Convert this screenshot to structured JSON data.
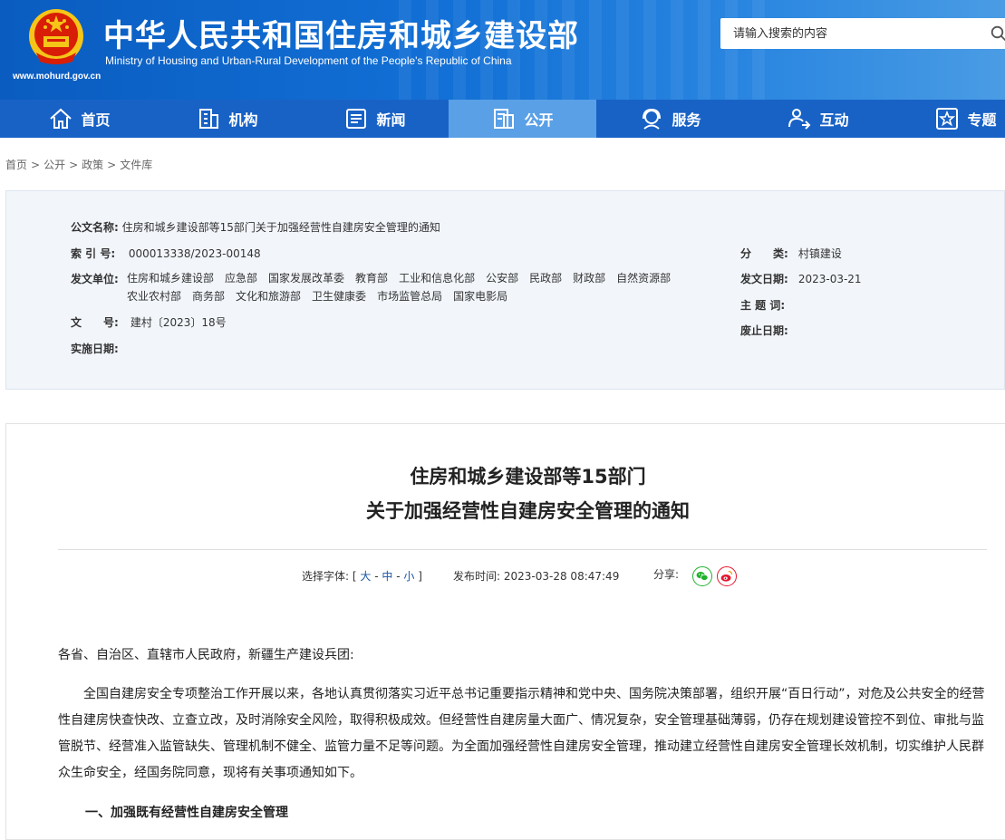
{
  "header": {
    "title_cn": "中华人民共和国住房和城乡建设部",
    "title_en": "Ministry of Housing and Urban-Rural Development of the People's Republic of China",
    "url": "www.mohurd.gov.cn",
    "search_placeholder": "请输入搜索的内容"
  },
  "nav": {
    "items": [
      {
        "label": "首页",
        "icon": "home-icon"
      },
      {
        "label": "机构",
        "icon": "building-icon"
      },
      {
        "label": "新闻",
        "icon": "news-icon"
      },
      {
        "label": "公开",
        "icon": "document-icon",
        "active": true
      },
      {
        "label": "服务",
        "icon": "service-icon"
      },
      {
        "label": "互动",
        "icon": "interaction-icon"
      },
      {
        "label": "专题",
        "icon": "star-icon"
      }
    ]
  },
  "breadcrumb": [
    "首页",
    "公开",
    "政策",
    "文件库"
  ],
  "meta": {
    "doc_name_label": "公文名称:",
    "doc_name": "住房和城乡建设部等15部门关于加强经营性自建房安全管理的通知",
    "index_label": "索 引 号:",
    "index": "000013338/2023-00148",
    "category_label": "分　　类:",
    "category": "村镇建设",
    "issuer_label": "发文单位:",
    "issuers": [
      "住房和城乡建设部",
      "应急部",
      "国家发展改革委",
      "教育部",
      "工业和信息化部",
      "公安部",
      "民政部",
      "财政部",
      "自然资源部",
      "农业农村部",
      "商务部",
      "文化和旅游部",
      "卫生健康委",
      "市场监管总局",
      "国家电影局"
    ],
    "issue_date_label": "发文日期:",
    "issue_date": "2023-03-21",
    "doc_no_label": "文　　号:",
    "doc_no": "建村〔2023〕18号",
    "keywords_label": "主 题 词:",
    "keywords": "",
    "abolish_label": "废止日期:",
    "abolish": "",
    "effective_label": "实施日期:",
    "effective": ""
  },
  "article": {
    "title_line1": "住房和城乡建设部等15部门",
    "title_line2": "关于加强经营性自建房安全管理的通知",
    "font_label": "选择字体:",
    "font_open": "[",
    "font_large": "大",
    "font_medium": "中",
    "font_small": "小",
    "font_dash": "-",
    "font_close": "]",
    "publish_label": "发布时间:",
    "publish_time": "2023-03-28 08:47:49",
    "share_label": "分享:",
    "salutation": "各省、自治区、直辖市人民政府，新疆生产建设兵团:",
    "paragraph1": "全国自建房安全专项整治工作开展以来，各地认真贯彻落实习近平总书记重要指示精神和党中央、国务院决策部署，组织开展“百日行动”，对危及公共安全的经营性自建房快查快改、立查立改，及时消除安全风险，取得积极成效。但经营性自建房量大面广、情况复杂，安全管理基础薄弱，仍存在规划建设管控不到位、审批与监管脱节、经营准入监管缺失、管理机制不健全、监管力量不足等问题。为全面加强经营性自建房安全管理，推动建立经营性自建房安全管理长效机制，切实维护人民群众生命安全，经国务院同意，现将有关事项通知如下。",
    "section1": "一、加强既有经营性自建房安全管理"
  },
  "colors": {
    "header_blue": "#1270d6",
    "nav_blue": "#1862c6",
    "nav_active": "#5aa0e6",
    "emblem_red": "#d81e06",
    "emblem_gold": "#f5c518",
    "wechat_green": "#20b02c",
    "weibo_red": "#e6162d"
  }
}
